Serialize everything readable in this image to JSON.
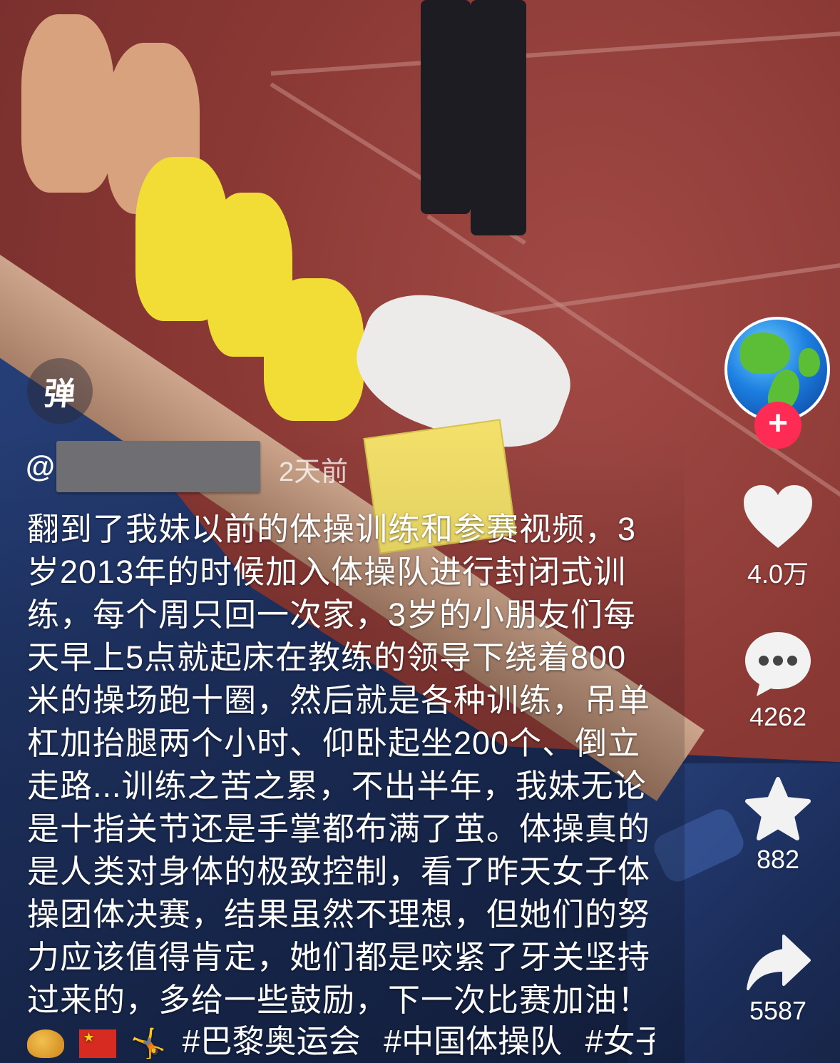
{
  "danmaku": {
    "label": "弹"
  },
  "author": {
    "at": "@",
    "posted": "2天前"
  },
  "caption": {
    "lines": [
      "翻到了我妹以前的体操训练和参赛视频，3",
      "岁2013年的时候加入体操队进行封闭式训",
      "练，每个周只回一次家，3岁的小朋友们每",
      "天早上5点就起床在教练的领导下绕着800",
      "米的操场跑十圈，然后就是各种训练，吊单",
      "杠加抬腿两个小时、仰卧起坐200个、倒立",
      "走路...训练之苦之累，不出半年，我妹无论",
      "是十指关节还是手掌都布满了茧。体操真的",
      "是人类对身体的极致控制，看了昨天女子体",
      "操团体决赛，结果虽然不理想，但她们的努",
      "力应该值得肯定，她们都是咬紧了牙关坚持",
      "过来的，多给一些鼓励，下一次比赛加油！"
    ],
    "emojis": [
      "muscle-emoji",
      "china-flag-emoji",
      "gymnast-emoji"
    ],
    "tags": [
      "#巴黎奥运会",
      "#中国体操队",
      "#女子"
    ]
  },
  "actions": {
    "like_count": "4.0万",
    "comment_count": "4262",
    "favorite_count": "882",
    "share_count": "5587"
  },
  "follow": {
    "label": "+"
  },
  "colors": {
    "follow_red": "#fe2c55",
    "text": "#ffffff"
  }
}
